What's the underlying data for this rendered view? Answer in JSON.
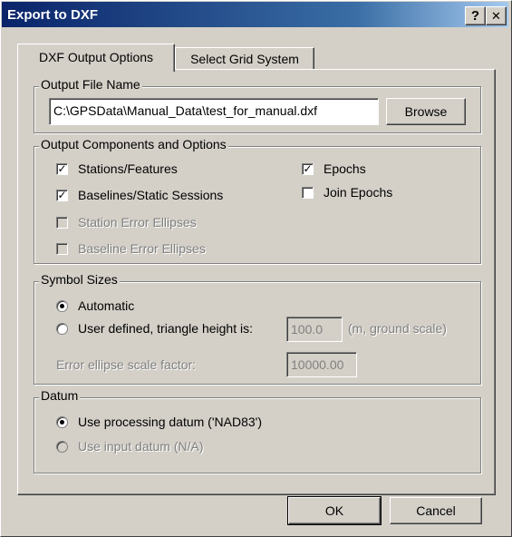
{
  "window": {
    "title": "Export to DXF",
    "help_glyph": "?",
    "close_glyph": "✕"
  },
  "tabs": [
    {
      "label": "DXF Output Options"
    },
    {
      "label": "Select Grid System"
    }
  ],
  "output_file": {
    "legend": "Output File Name",
    "value": "C:\\GPSData\\Manual_Data\\test_for_manual.dxf",
    "browse_label": "Browse"
  },
  "components": {
    "legend": "Output Components and Options",
    "items": [
      {
        "label": "Stations/Features",
        "checked": true,
        "enabled": true
      },
      {
        "label": "Baselines/Static Sessions",
        "checked": true,
        "enabled": true
      },
      {
        "label": "Station Error Ellipses",
        "checked": false,
        "enabled": false
      },
      {
        "label": "Baseline Error Ellipses",
        "checked": false,
        "enabled": false
      },
      {
        "label": "Epochs",
        "checked": true,
        "enabled": true
      },
      {
        "label": "Join Epochs",
        "checked": false,
        "enabled": true
      }
    ]
  },
  "symbol_sizes": {
    "legend": "Symbol Sizes",
    "automatic_label": "Automatic",
    "user_defined_label": "User defined, triangle height is:",
    "selected": "Automatic",
    "triangle_height": "100.0",
    "triangle_units": "(m, ground scale)",
    "ellipse_label": "Error ellipse scale factor:",
    "ellipse_value": "10000.00"
  },
  "datum": {
    "legend": "Datum",
    "processing_label": "Use processing datum ('NAD83')",
    "input_label": "Use input datum (N/A)",
    "selected": "processing"
  },
  "footer": {
    "ok_label": "OK",
    "cancel_label": "Cancel"
  }
}
